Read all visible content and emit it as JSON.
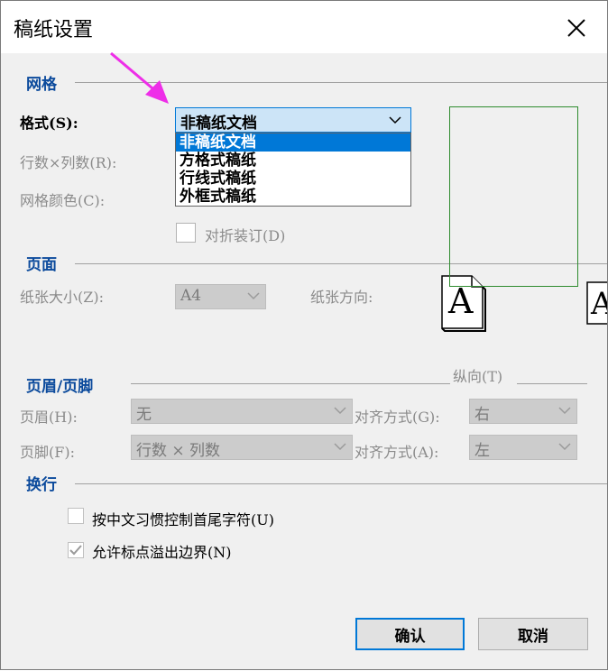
{
  "window": {
    "title": "稿纸设置"
  },
  "sections": {
    "grid": "网格",
    "page": "页面",
    "header_footer": "页眉/页脚",
    "line_break": "换行"
  },
  "grid": {
    "format_label": "格式(S):",
    "format_value": "非稿纸文档",
    "format_options": [
      "非稿纸文档",
      "方格式稿纸",
      "行线式稿纸",
      "外框式稿纸"
    ],
    "rows_cols_label": "行数×列数(R):",
    "grid_color_label": "网格颜色(C):",
    "fold_binding_label": "对折装订(D)"
  },
  "page": {
    "paper_size_label": "纸张大小(Z):",
    "paper_size_value": "A4",
    "orientation_label": "纸张方向:",
    "portrait_label": "纵向(T)",
    "orientation_icon_letter": "A"
  },
  "header_footer": {
    "header_label": "页眉(H):",
    "header_value": "无",
    "header_align_label": "对齐方式(G):",
    "header_align_value": "右",
    "footer_label": "页脚(F):",
    "footer_value": "行数 × 列数",
    "footer_align_label": "对齐方式(A):",
    "footer_align_value": "左"
  },
  "line_break": {
    "cjk_control_label": "按中文习惯控制首尾字符(U)",
    "cjk_control_checked": false,
    "punct_overflow_label": "允许标点溢出边界(N)",
    "punct_overflow_checked": true
  },
  "buttons": {
    "ok": "确认",
    "cancel": "取消"
  },
  "colors": {
    "section_blue": "#0b4a9c",
    "highlight": "#0078d7",
    "annotation_arrow": "#ee2ee8",
    "preview_border": "#2e8b2e"
  }
}
